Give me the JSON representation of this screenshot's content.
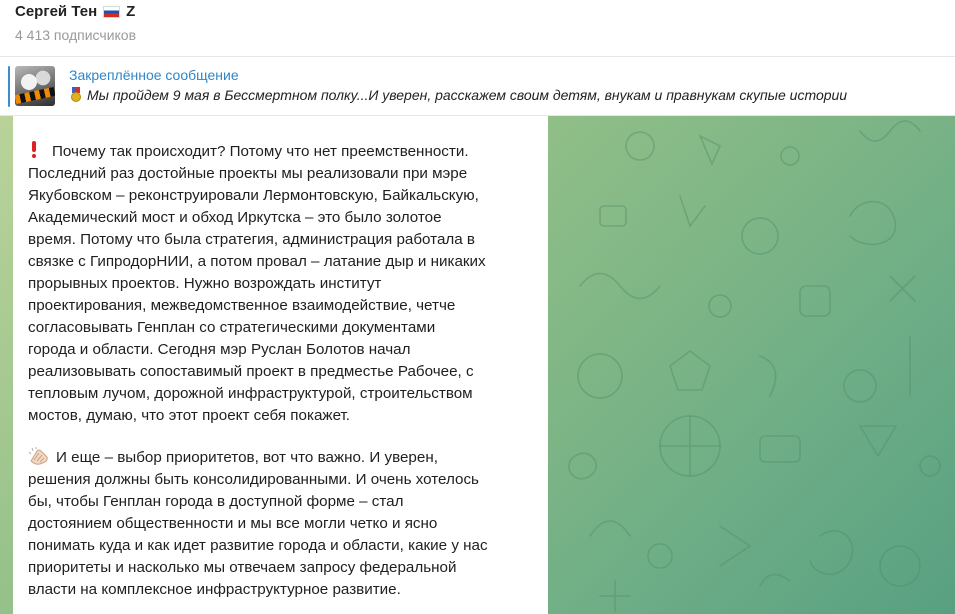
{
  "channel": {
    "name": "Сергей Тен",
    "suffix": "Z",
    "flag_icon": "russia-flag-icon",
    "subscribers": "4 413 подписчиков"
  },
  "pinned": {
    "title": "Закреплённое сообщение",
    "icon": "medal-icon",
    "text": "Мы пройдем 9 мая в Бессмертном полку...И уверен, расскажем своим детям, внукам и правнукам скупые истории"
  },
  "message": {
    "paragraph1_icon": "red-exclamation-icon",
    "paragraph1_lines": [
      "Почему так происходит? Потому что нет преемственности.",
      "Последний раз достойные проекты мы реализовали при мэре",
      "Якубовском – реконструировали Лермонтовскую, Байкальскую,",
      "Академический мост и обход Иркутска – это было золотое",
      "время. Потому что была стратегия, администрация работала в",
      "связке с ГипродорНИИ, а потом провал – латание дыр и никаких",
      "прорывных проектов. Нужно возрождать институт",
      "проектирования, межведомственное  взаимодействие, четче",
      "согласовывать Генплан со стратегическими документами",
      "города и области. Сегодня мэр Руслан Болотов начал",
      "реализовывать сопоставимый проект в предместье Рабочее, с",
      "тепловым лучом, дорожной инфраструктурой, строительством",
      "мостов, думаю, что этот проект себя  покажет."
    ],
    "paragraph2_icon": "clapping-hands-icon",
    "paragraph2_lines": [
      "И еще – выбор приоритетов, вот что важно. И уверен,",
      "решения должны быть консолидированными. И очень хотелось",
      "бы, чтобы Генплан города в доступной форме  – стал",
      "достоянием общественности и мы все могли четко и ясно",
      "понимать куда и как идет развитие города и области, какие у нас",
      "приоритеты и насколько мы отвечаем запросу федеральной",
      "власти на комплексное инфраструктурное развитие."
    ]
  },
  "colors": {
    "accent": "#2f86c9",
    "background_green_light": "#b9d39a",
    "background_green_dark": "#58a082",
    "alert_red": "#e02020"
  }
}
